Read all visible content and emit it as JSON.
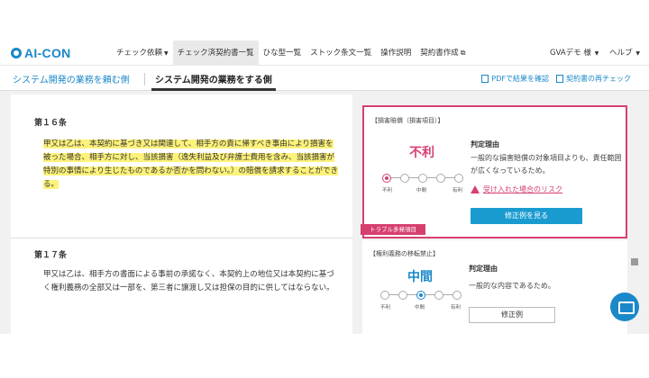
{
  "brand": {
    "logo_text": "AI-CON",
    "accent": "#1a88c9",
    "danger": "#d6406f"
  },
  "nav": {
    "items": [
      {
        "label": "チェック依頼",
        "caret": true
      },
      {
        "label": "チェック済契約書一覧",
        "active": true
      },
      {
        "label": "ひな型一覧"
      },
      {
        "label": "ストック条文一覧"
      },
      {
        "label": "操作説明"
      },
      {
        "label": "契約書作成"
      }
    ],
    "user": "GVAデモ 様",
    "help": "ヘルプ"
  },
  "tabs": {
    "client": "システム開発の業務を頼む側",
    "vendor": "システム開発の業務をする側"
  },
  "actions": {
    "pdf": "PDFで結果を確認",
    "recheck": "契約書の再チェック"
  },
  "articles": [
    {
      "title": "第１６条",
      "body": "甲又は乙は、本契約に基づき又は関連して、相手方の責に帰すべき事由により損害を被った場合、相手方に対し、当該損害（逸失利益及び弁護士費用を含み、当該損害が特別の事情により生じたものであるか否かを問わない。）の賠償を請求することができる。"
    },
    {
      "title": "第１７条",
      "body": "甲又は乙は、相手方の書面による事前の承諾なく、本契約上の地位又は本契約に基づく権利義務の全部又は一部を、第三者に譲渡し又は担保の目的に供してはならない。"
    }
  ],
  "risk_cards": [
    {
      "category": "【損害賠償（損害項目）】",
      "level": "不利",
      "scale": [
        "不利",
        "中間",
        "有利"
      ],
      "reason_title": "判定理由",
      "reason": "一般的な損害賠償の対象項目よりも、責任範囲が広くなっているため。",
      "risk_link": "受け入れた場合のリスク",
      "button": "修正例を見る",
      "tag": "トラブル多発項目"
    },
    {
      "category": "【権利義務の移転禁止】",
      "level": "中間",
      "scale": [
        "不利",
        "中間",
        "有利"
      ],
      "reason_title": "判定理由",
      "reason": "一般的な内容であるため。",
      "button": "修正例"
    }
  ]
}
